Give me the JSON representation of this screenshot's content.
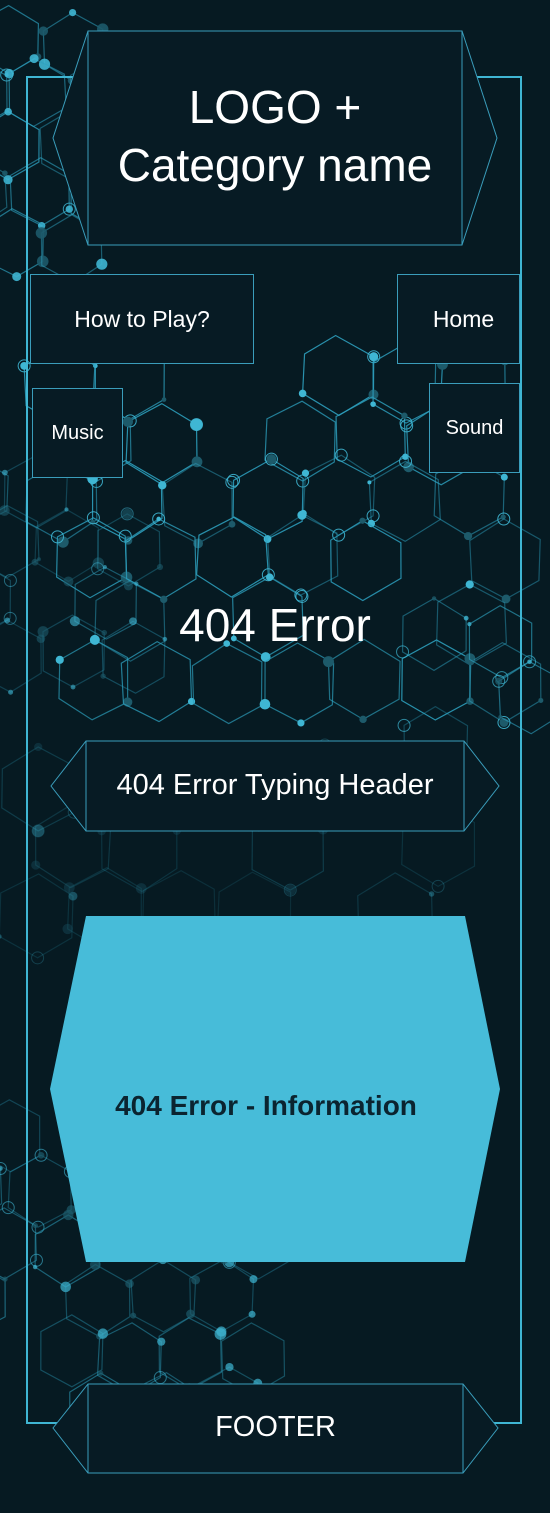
{
  "header": {
    "logo_line1": "LOGO +",
    "logo_line2": "Category name"
  },
  "nav": {
    "how_to_play": "How to Play?",
    "home": "Home",
    "music": "Music",
    "sound": "Sound"
  },
  "main": {
    "error_title": "404 Error",
    "typing_header": "404 Error Typing Header",
    "information": "404 Error - Information"
  },
  "footer": {
    "label": "FOOTER"
  },
  "colors": {
    "background": "#061a22",
    "accent": "#3fb6d3",
    "panel": "#071b24",
    "info_panel": "#47bcd9"
  }
}
